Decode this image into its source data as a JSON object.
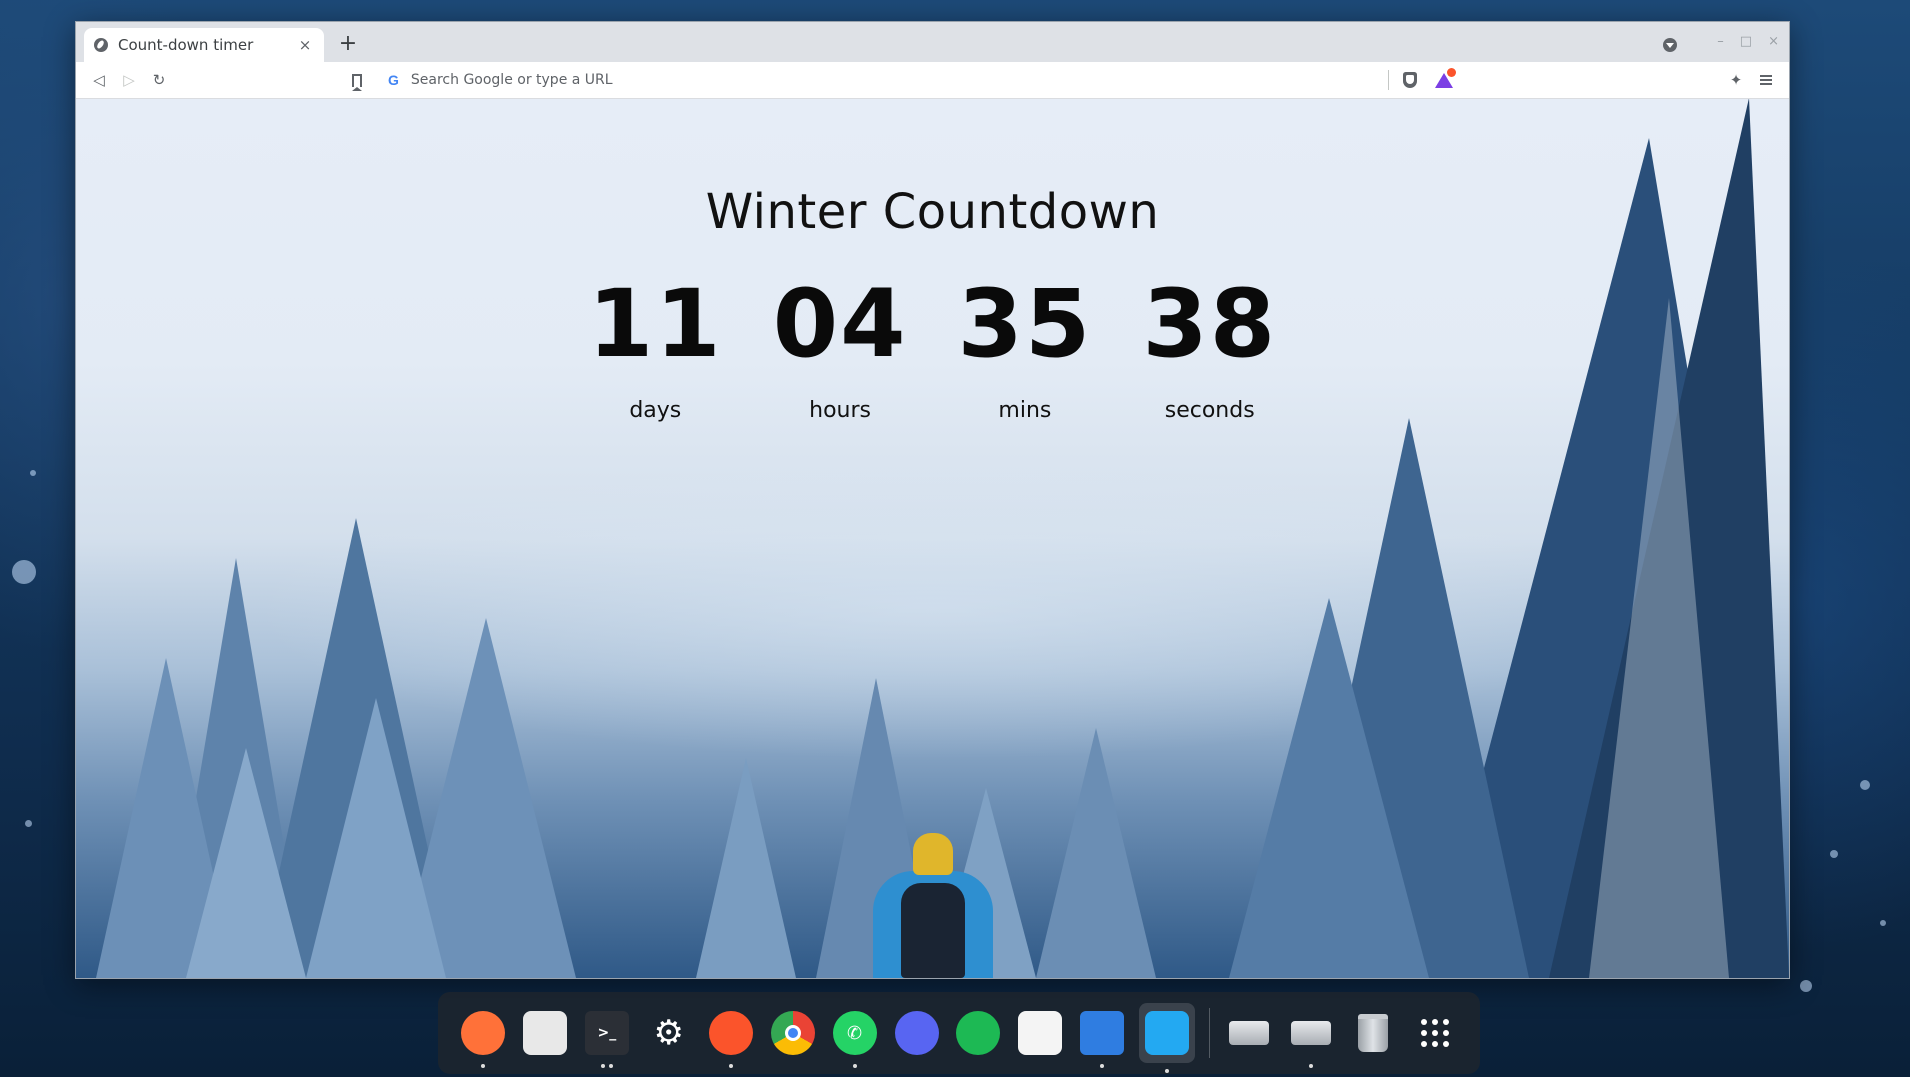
{
  "browser": {
    "tab": {
      "title": "Count-down timer",
      "close": "×"
    },
    "new_tab": "+",
    "window_controls": {
      "minimize": "–",
      "maximize": "□",
      "close": "×"
    },
    "nav": {
      "back": "◁",
      "forward": "▷",
      "reload": "↻"
    },
    "omnibox": {
      "icon": "G",
      "placeholder": "Search Google or type a URL"
    },
    "extensions_icon": "✦"
  },
  "page": {
    "title": "Winter Countdown",
    "units": [
      {
        "value": "11",
        "label": "days"
      },
      {
        "value": "04",
        "label": "hours"
      },
      {
        "value": "35",
        "label": "mins"
      },
      {
        "value": "38",
        "label": "seconds"
      }
    ]
  },
  "dock": {
    "apps": [
      {
        "name": "firefox-icon",
        "glyph": "",
        "color": "#ff7139",
        "dots": 1
      },
      {
        "name": "software-store-icon",
        "glyph": "",
        "color": "#e8e8e8",
        "dots": 0
      },
      {
        "name": "terminal-icon",
        "glyph": ">_",
        "color": "#2b2f36",
        "dots": 2
      },
      {
        "name": "settings-icon",
        "glyph": "⚙",
        "color": "#3a3f47",
        "dots": 0
      },
      {
        "name": "brave-icon",
        "glyph": "",
        "color": "#fb542b",
        "dots": 1
      },
      {
        "name": "chrome-icon",
        "glyph": "",
        "color": "#34a853",
        "dots": 0
      },
      {
        "name": "whatsapp-icon",
        "glyph": "✆",
        "color": "#25d366",
        "dots": 1
      },
      {
        "name": "discord-icon",
        "glyph": "",
        "color": "#5865f2",
        "dots": 0
      },
      {
        "name": "spotify-icon",
        "glyph": "",
        "color": "#1db954",
        "dots": 0
      },
      {
        "name": "calendar-icon",
        "glyph": "",
        "color": "#f4f4f4",
        "dots": 0
      },
      {
        "name": "file-manager-icon",
        "glyph": "",
        "color": "#2f7de1",
        "dots": 1
      },
      {
        "name": "vscode-icon",
        "glyph": "",
        "color": "#23a9f2",
        "dots": 1
      }
    ],
    "devices": [
      {
        "name": "drive-icon",
        "dots": 0
      },
      {
        "name": "drive-icon",
        "dots": 1
      },
      {
        "name": "trash-icon",
        "dots": 0
      }
    ]
  }
}
